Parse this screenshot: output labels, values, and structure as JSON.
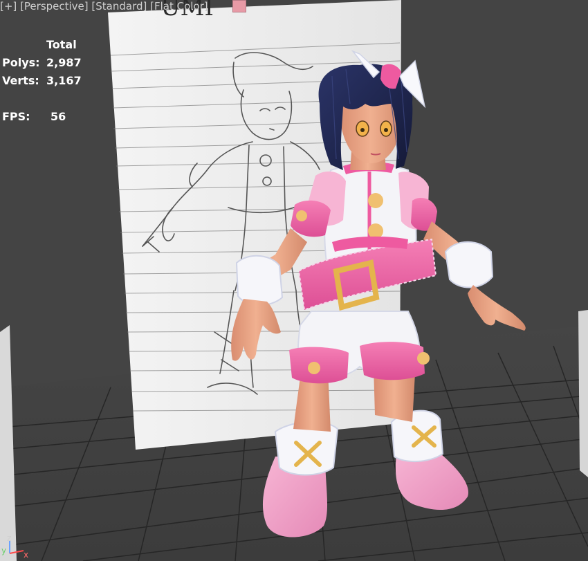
{
  "viewport": {
    "menu": {
      "view_mode": "[+]",
      "camera": "[Perspective]",
      "shading": "[Standard]",
      "display": "[Flat Color]"
    },
    "active_color": "#e79aa6",
    "reference_text": "UMI",
    "stats": {
      "total_label": "Total",
      "polys_label": "Polys:",
      "polys_value": "2,987",
      "verts_label": "Verts:",
      "verts_value": "3,167",
      "fps_label": "FPS:",
      "fps_value": "56"
    },
    "axis": {
      "z": "z",
      "y": "y",
      "x": "x"
    }
  },
  "colors": {
    "background": "#444444",
    "grid_line": "#2a2a2a",
    "outfit_pink": "#ee6aa6",
    "outfit_white": "#f4f4f8",
    "hair": "#1c2246",
    "skin": "#e8a485"
  }
}
